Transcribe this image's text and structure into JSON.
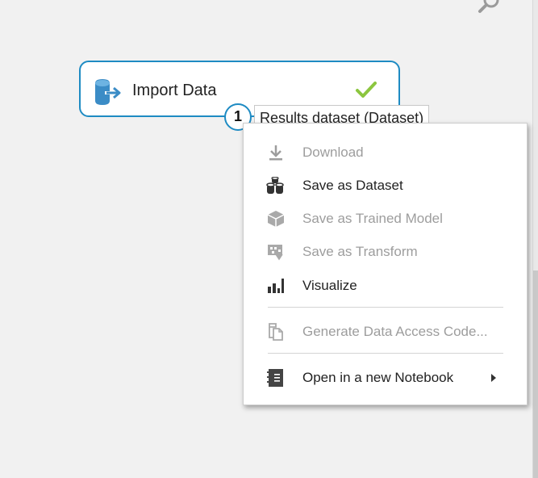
{
  "node": {
    "title": "Import Data",
    "status": "completed",
    "output_port": {
      "number": "1",
      "tooltip": "Results dataset (Dataset)"
    }
  },
  "context_menu": {
    "items": [
      {
        "label": "Download",
        "icon": "download-icon",
        "enabled": false
      },
      {
        "label": "Save as Dataset",
        "icon": "save-dataset-icon",
        "enabled": true
      },
      {
        "label": "Save as Trained Model",
        "icon": "trained-model-icon",
        "enabled": false
      },
      {
        "label": "Save as Transform",
        "icon": "transform-icon",
        "enabled": false
      },
      {
        "label": "Visualize",
        "icon": "visualize-icon",
        "enabled": true
      },
      {
        "label": "Generate Data Access Code...",
        "icon": "data-access-code-icon",
        "enabled": false
      },
      {
        "label": "Open in a new Notebook",
        "icon": "notebook-icon",
        "enabled": true,
        "has_submenu": true
      }
    ]
  },
  "colors": {
    "accent": "#1e8bc3",
    "success": "#8cc63f",
    "disabled_text": "#9d9d9d",
    "background": "#f1f1f1"
  }
}
